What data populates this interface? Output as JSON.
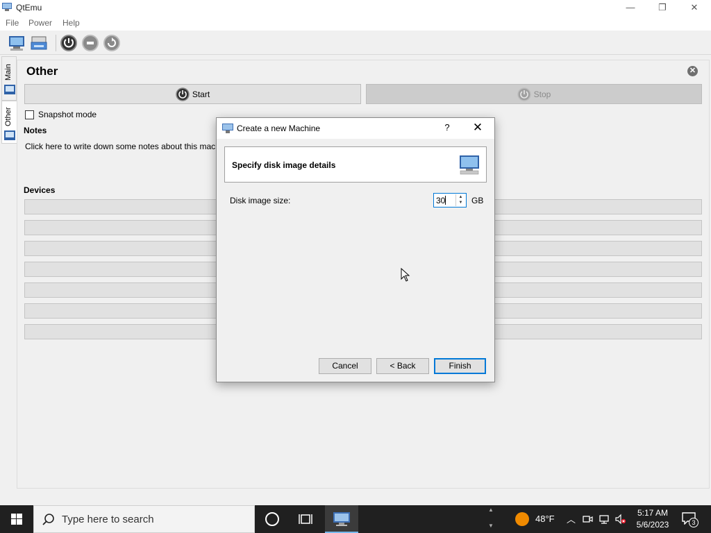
{
  "window": {
    "title": "QtEmu",
    "minimize_glyph": "—",
    "restore_glyph": "❐",
    "close_glyph": "✕"
  },
  "menu": [
    "File",
    "Power",
    "Help"
  ],
  "side_tabs": [
    "Main",
    "Other"
  ],
  "vm_panel": {
    "title": "Other",
    "close_glyph": "✕",
    "start_label": "Start",
    "stop_label": "Stop",
    "snapshot_label": "Snapshot mode",
    "notes_heading": "Notes",
    "notes_text": "Click here to write down some notes about this machine.",
    "devices_heading": "Devices"
  },
  "dialog": {
    "title": "Create a new Machine",
    "help_glyph": "?",
    "close_glyph": "✕",
    "header": "Specify disk image details",
    "size_label": "Disk image size:",
    "size_value": "30",
    "size_unit": "GB",
    "buttons": {
      "cancel": "Cancel",
      "back": "< Back",
      "finish": "Finish"
    }
  },
  "taskbar": {
    "search_placeholder": "Type here to search",
    "temperature": "48°F",
    "time": "5:17 AM",
    "date": "5/6/2023",
    "notification_count": "3"
  },
  "colors": {
    "accent": "#0078d7",
    "taskbar": "#202020",
    "weather": "#f08a00"
  }
}
